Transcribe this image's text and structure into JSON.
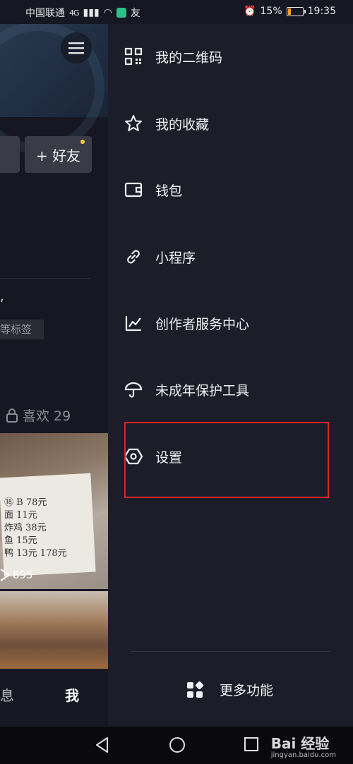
{
  "status_bar": {
    "carrier": "中国联通",
    "network": "4G",
    "battery": "15%",
    "time": "19:35"
  },
  "profile_behind": {
    "add_friend_label": "+ 好友",
    "tag_text": "等标签",
    "likes_label": "喜欢 29",
    "view_count": "895",
    "nav_messages": "息",
    "nav_me": "我",
    "photo_text_lines": [
      "⑱ B 78元",
      "面 11元",
      "炸鸡 38元",
      "鱼 15元",
      "鸭 13元 178元"
    ]
  },
  "drawer": {
    "items": [
      {
        "label": "我的二维码",
        "icon": "qr-code-icon"
      },
      {
        "label": "我的收藏",
        "icon": "star-icon"
      },
      {
        "label": "钱包",
        "icon": "wallet-icon"
      },
      {
        "label": "小程序",
        "icon": "link-icon"
      },
      {
        "label": "创作者服务中心",
        "icon": "chart-icon"
      },
      {
        "label": "未成年保护工具",
        "icon": "umbrella-icon"
      },
      {
        "label": "设置",
        "icon": "settings-hexagon-icon"
      }
    ],
    "more_label": "更多功能",
    "highlight_color": "#d8242b"
  },
  "watermark": {
    "brand": "Bai 经验",
    "url": "jingyan.baidu.com"
  }
}
